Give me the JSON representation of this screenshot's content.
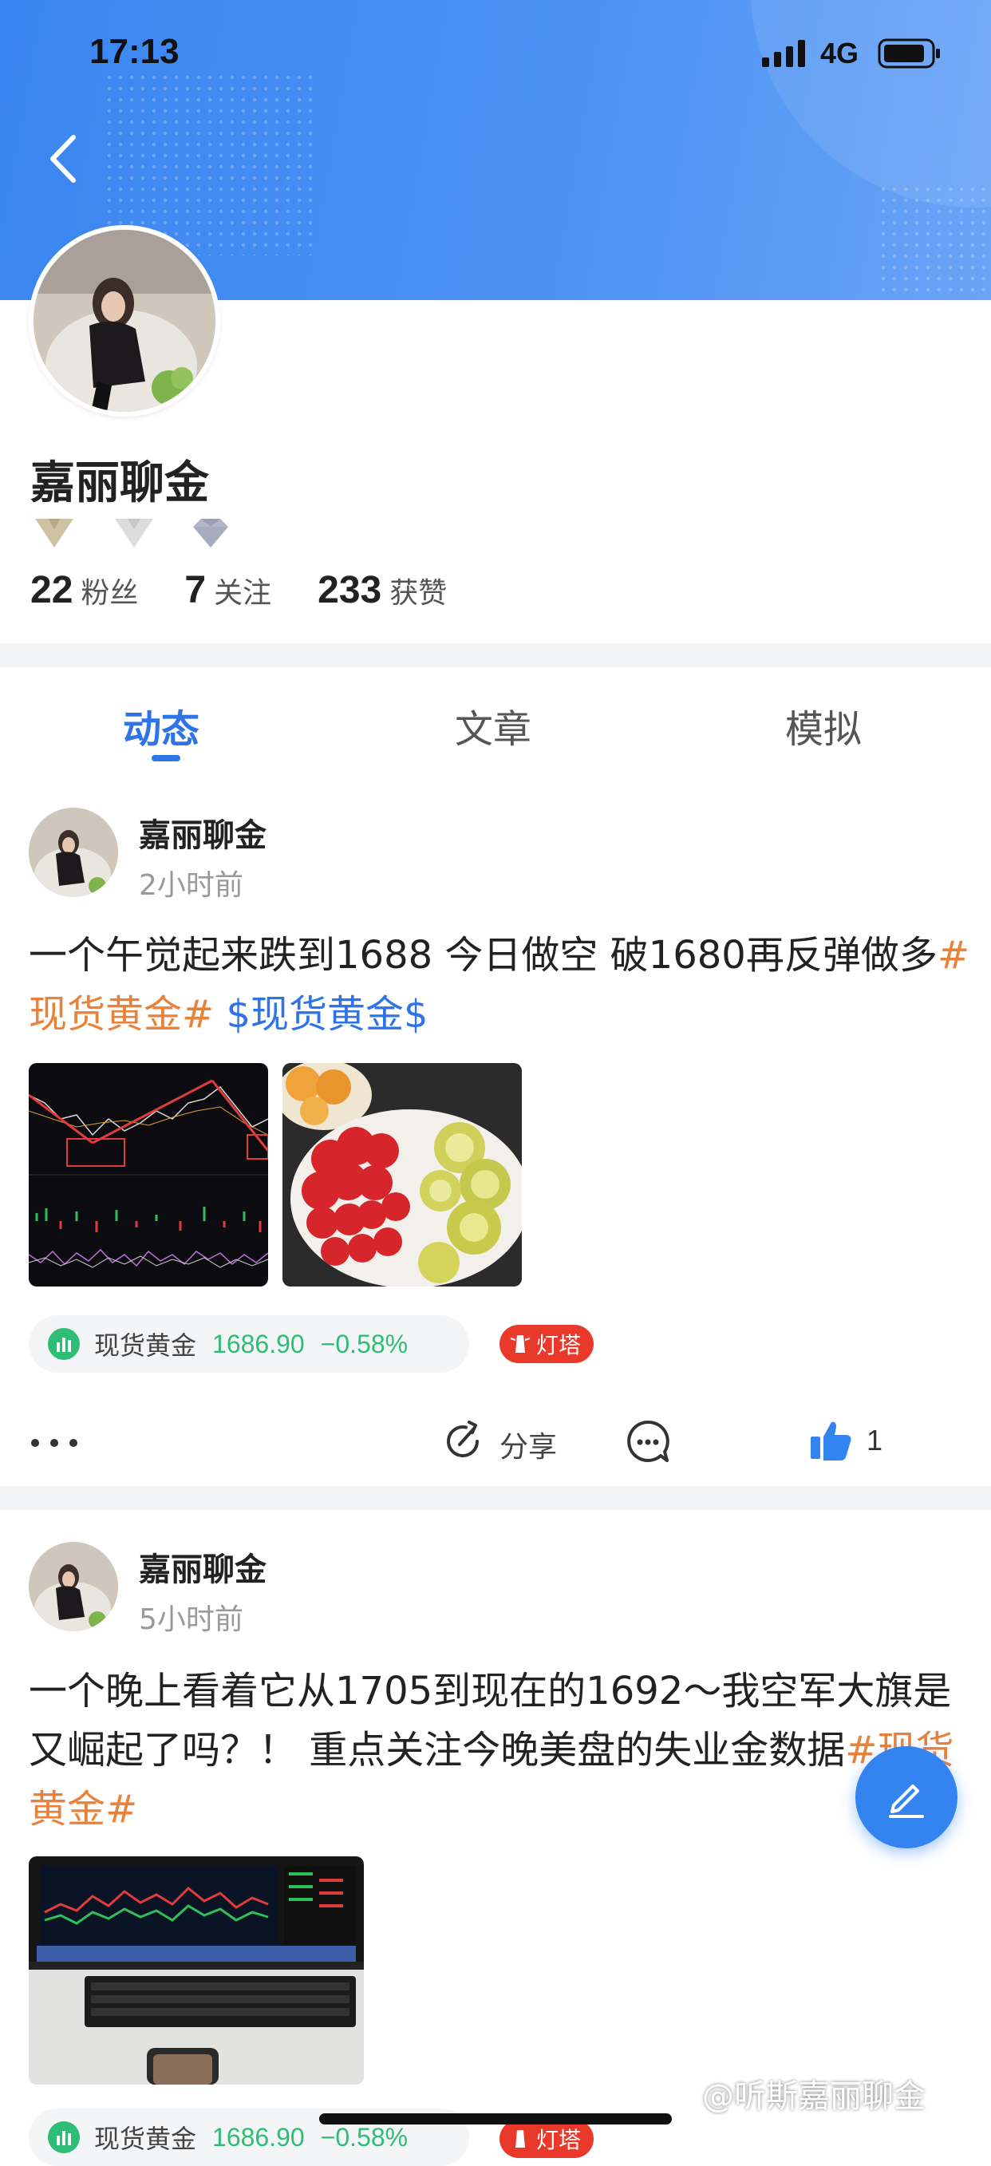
{
  "status_bar": {
    "time": "17:13",
    "network": "4G"
  },
  "profile": {
    "name": "嘉丽聊金",
    "stats": [
      {
        "value": "22",
        "label": "粉丝"
      },
      {
        "value": "7",
        "label": "关注"
      },
      {
        "value": "233",
        "label": "获赞"
      }
    ]
  },
  "tabs": [
    "动态",
    "文章",
    "模拟"
  ],
  "posts": [
    {
      "author": "嘉丽聊金",
      "time": "2小时前",
      "text_plain": "一个午觉起来跌到1688 今日做空 破1680再反弹做多",
      "hashtag": "#现货黄金#",
      "cashtag": "$现货黄金$",
      "ticker": {
        "name": "现货黄金",
        "price": "1686.90",
        "change": "−0.58%"
      },
      "badge": "灯塔",
      "share_label": "分享",
      "likes": "1"
    },
    {
      "author": "嘉丽聊金",
      "time": "5小时前",
      "text_plain": "一个晚上看着它从1705到现在的1692～我空军大旗是又崛起了吗？！ 重点关注今晚美盘的失业金数据",
      "hashtag": "#现货黄金#",
      "ticker": {
        "name": "现货黄金",
        "price": "1686.90",
        "change": "−0.58%"
      },
      "badge": "灯塔"
    }
  ],
  "watermark": "@听斯嘉丽聊金",
  "colors": {
    "accent": "#2f73e8",
    "hashtag": "#e8823a",
    "up_down": "#2ebd74",
    "badge": "#e8392b"
  }
}
